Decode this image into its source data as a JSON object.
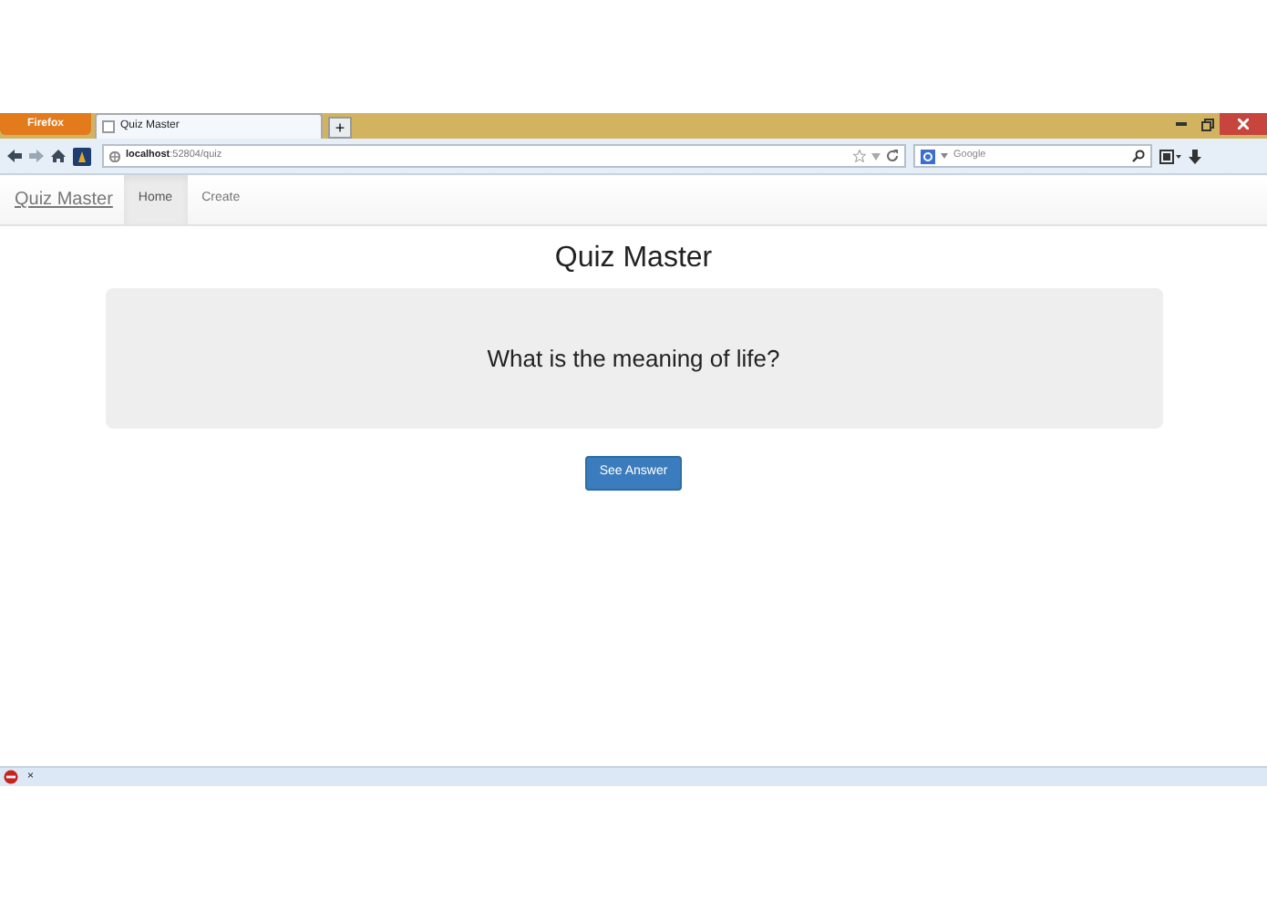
{
  "browser": {
    "menu_button": "Firefox",
    "tabs": [
      {
        "title": "Quiz Master",
        "selected": true
      }
    ],
    "new_tab": "+",
    "url_host": "localhost",
    "url_path": ":52804/quiz",
    "search_placeholder": "Google",
    "addon_close": "×"
  },
  "navbar": {
    "brand": "Quiz Master",
    "links": [
      {
        "label": "Home",
        "selected": true
      },
      {
        "label": "Create",
        "selected": false
      }
    ]
  },
  "page": {
    "heading": "Quiz Master",
    "question": "What is the meaning of life?",
    "button": "See Answer"
  }
}
